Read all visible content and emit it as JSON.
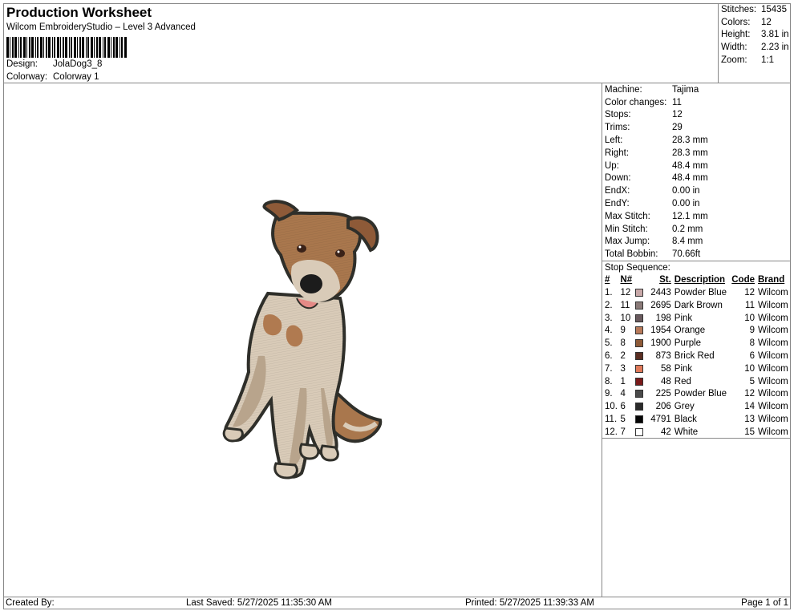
{
  "header": {
    "title": "Production Worksheet",
    "subtitle": "Wilcom EmbroideryStudio – Level 3 Advanced",
    "design_label": "Design:",
    "design_value": "JolaDog3_8",
    "colorway_label": "Colorway:",
    "colorway_value": "Colorway 1"
  },
  "summary": [
    {
      "label": "Stitches:",
      "value": "15435"
    },
    {
      "label": "Colors:",
      "value": "12"
    },
    {
      "label": "Height:",
      "value": "3.81 in"
    },
    {
      "label": "Width:",
      "value": "2.23 in"
    },
    {
      "label": "Zoom:",
      "value": "1:1"
    }
  ],
  "machine_info": [
    {
      "label": "Machine:",
      "value": "Tajima"
    },
    {
      "label": "Color changes:",
      "value": "11"
    },
    {
      "label": "Stops:",
      "value": "12"
    },
    {
      "label": "Trims:",
      "value": "29"
    },
    {
      "label": "Left:",
      "value": "28.3 mm"
    },
    {
      "label": "Right:",
      "value": "28.3 mm"
    },
    {
      "label": "Up:",
      "value": "48.4 mm"
    },
    {
      "label": "Down:",
      "value": "48.4 mm"
    },
    {
      "label": "EndX:",
      "value": "0.00 in"
    },
    {
      "label": "EndY:",
      "value": "0.00 in"
    },
    {
      "label": "Max Stitch:",
      "value": "12.1 mm"
    },
    {
      "label": "Min Stitch:",
      "value": "0.2 mm"
    },
    {
      "label": "Max Jump:",
      "value": "8.4 mm"
    },
    {
      "label": "Total Bobbin:",
      "value": "70.66ft"
    }
  ],
  "stop_sequence": {
    "title": "Stop Sequence:",
    "headers": {
      "num": "#",
      "n": "N#",
      "st": "St.",
      "desc": "Description",
      "code": "Code",
      "brand": "Brand"
    },
    "rows": [
      {
        "num": "1.",
        "n": "12",
        "color": "#c8a8a8",
        "st": "2443",
        "desc": "Powder Blue",
        "code": "12",
        "brand": "Wilcom"
      },
      {
        "num": "2.",
        "n": "11",
        "color": "#8a7a78",
        "st": "2695",
        "desc": "Dark Brown",
        "code": "11",
        "brand": "Wilcom"
      },
      {
        "num": "3.",
        "n": "10",
        "color": "#6a5a5e",
        "st": "198",
        "desc": "Pink",
        "code": "10",
        "brand": "Wilcom"
      },
      {
        "num": "4.",
        "n": "9",
        "color": "#b87a5a",
        "st": "1954",
        "desc": "Orange",
        "code": "9",
        "brand": "Wilcom"
      },
      {
        "num": "5.",
        "n": "8",
        "color": "#8e5a38",
        "st": "1900",
        "desc": "Purple",
        "code": "8",
        "brand": "Wilcom"
      },
      {
        "num": "6.",
        "n": "2",
        "color": "#5a2e22",
        "st": "873",
        "desc": "Brick Red",
        "code": "6",
        "brand": "Wilcom"
      },
      {
        "num": "7.",
        "n": "3",
        "color": "#e07a5a",
        "st": "58",
        "desc": "Pink",
        "code": "10",
        "brand": "Wilcom"
      },
      {
        "num": "8.",
        "n": "1",
        "color": "#7a1a1a",
        "st": "48",
        "desc": "Red",
        "code": "5",
        "brand": "Wilcom"
      },
      {
        "num": "9.",
        "n": "4",
        "color": "#4a4a4a",
        "st": "225",
        "desc": "Powder Blue",
        "code": "12",
        "brand": "Wilcom"
      },
      {
        "num": "10.",
        "n": "6",
        "color": "#2a2a2a",
        "st": "206",
        "desc": "Grey",
        "code": "14",
        "brand": "Wilcom"
      },
      {
        "num": "11.",
        "n": "5",
        "color": "#050505",
        "st": "4791",
        "desc": "Black",
        "code": "13",
        "brand": "Wilcom"
      },
      {
        "num": "12.",
        "n": "7",
        "color": "#ffffff",
        "st": "42",
        "desc": "White",
        "code": "15",
        "brand": "Wilcom"
      }
    ]
  },
  "footer": {
    "created_by": "Created By:",
    "last_saved": "Last Saved: 5/27/2025 11:35:30 AM",
    "printed": "Printed: 5/27/2025 11:39:33 AM",
    "page": "Page 1 of 1"
  },
  "colors": {
    "fur_tan": "#a9774d",
    "fur_light": "#d9cbb8",
    "fur_mid": "#b8a48c",
    "outline": "#2f2f2a",
    "nose": "#1c1c1c",
    "tongue": "#e48a86"
  }
}
